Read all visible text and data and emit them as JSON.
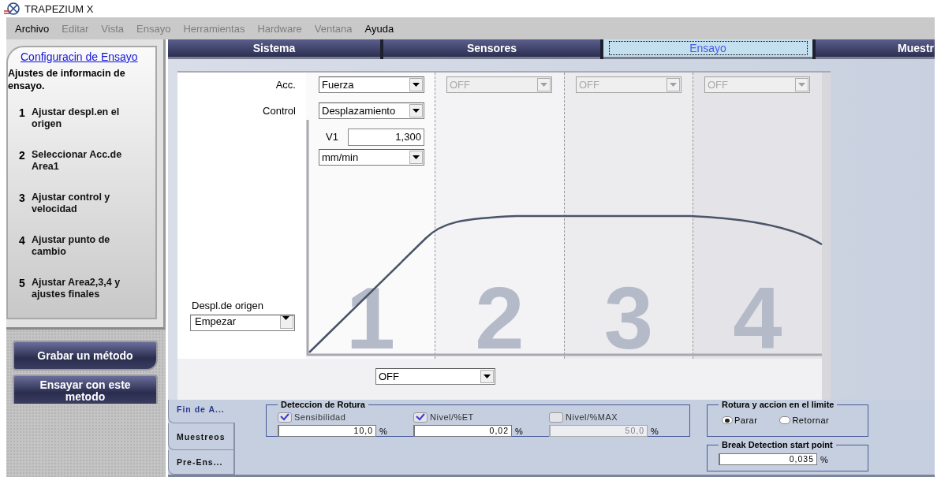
{
  "window": {
    "title": "TRAPEZIUM X"
  },
  "menu": [
    {
      "label": "Archivo",
      "disabled": false
    },
    {
      "label": "Editar",
      "disabled": true
    },
    {
      "label": "Vista",
      "disabled": true
    },
    {
      "label": "Ensayo",
      "disabled": true
    },
    {
      "label": "Herramientas",
      "disabled": true
    },
    {
      "label": "Hardware",
      "disabled": true
    },
    {
      "label": "Ventana",
      "disabled": true
    },
    {
      "label": "Ayuda",
      "disabled": false
    }
  ],
  "sidebar": {
    "title": "Configuracin de Ensayo",
    "description": "Ajustes de informacin de ensayo.",
    "steps": [
      {
        "number": "1",
        "text": "Ajustar despl.en el origen"
      },
      {
        "number": "2",
        "text": "Seleccionar Acc.de Area1"
      },
      {
        "number": "3",
        "text": "Ajustar control y velocidad"
      },
      {
        "number": "4",
        "text": "Ajustar punto de cambio"
      },
      {
        "number": "5",
        "text": "Ajustar Area2,3,4 y ajustes finales"
      }
    ],
    "buttons": [
      "Grabar un método",
      "Ensayar con este metodo"
    ]
  },
  "tabs": [
    {
      "label": "Sistema",
      "selected": false
    },
    {
      "label": "Sensores",
      "selected": false
    },
    {
      "label": "Ensayo",
      "selected": true
    },
    {
      "label": "Muestr",
      "selected": false
    }
  ],
  "setup": {
    "acc_label": "Acc.",
    "control_label": "Control",
    "origin_label": "Despl.de origen",
    "origin_value": "Empezar",
    "areas": [
      {
        "number": "1",
        "acc": "Fuerza",
        "disabled": false,
        "control": "Desplazamiento",
        "speed_label": "V1",
        "speed": "1,300",
        "unit": "mm/min"
      },
      {
        "number": "2",
        "acc": "OFF",
        "disabled": true
      },
      {
        "number": "3",
        "acc": "OFF",
        "disabled": true
      },
      {
        "number": "4",
        "acc": "OFF",
        "disabled": true
      }
    ],
    "end_select": "OFF"
  },
  "bottom": {
    "side_tabs": [
      {
        "label": "Fin de A...",
        "selected": true
      },
      {
        "label": "Muestreos",
        "selected": false
      },
      {
        "label": "Pre-Ens...",
        "selected": false
      }
    ],
    "break_detection": {
      "title": "Deteccion de Rotura",
      "items": [
        {
          "label": "Sensibilidad",
          "checked": true,
          "value": "10,0",
          "unit": "%"
        },
        {
          "label": "Nivel/%ET",
          "checked": true,
          "value": "0,02",
          "unit": "%"
        },
        {
          "label": "Nivel/%MAX",
          "checked": false,
          "value": "50,0",
          "unit": "%"
        }
      ]
    },
    "limit_action": {
      "title": "Rotura y accion en el limite",
      "options": [
        {
          "label": "Parar",
          "selected": true
        },
        {
          "label": "Retornar",
          "selected": false
        }
      ]
    },
    "start_point": {
      "title": "Break Detection start point",
      "value": "0,035",
      "unit": "%"
    }
  }
}
